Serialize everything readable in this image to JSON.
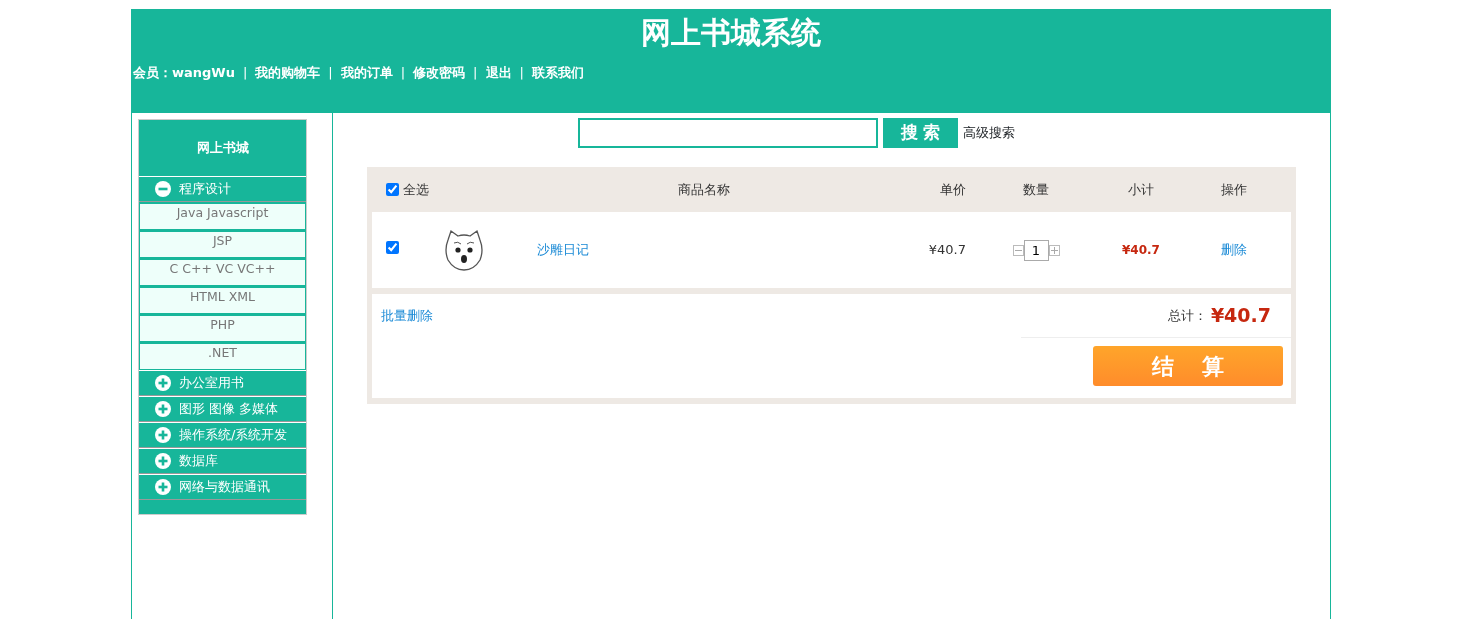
{
  "header": {
    "title": "网上书城系统",
    "member": "会员：wangWu",
    "separator": "|",
    "links": [
      "我的购物车",
      "我的订单",
      "修改密码",
      "退出",
      "联系我们"
    ]
  },
  "sidebar": {
    "title": "网上书城",
    "categories": [
      {
        "label": "程序设计",
        "expanded": true,
        "children": [
          "Java Javascript",
          "JSP",
          "C C++ VC VC++",
          "HTML XML",
          "PHP",
          ".NET"
        ]
      },
      {
        "label": "办公室用书",
        "expanded": false
      },
      {
        "label": "图形 图像 多媒体",
        "expanded": false
      },
      {
        "label": "操作系统/系统开发",
        "expanded": false
      },
      {
        "label": "数据库",
        "expanded": false
      },
      {
        "label": "网络与数据通讯",
        "expanded": false
      }
    ]
  },
  "search": {
    "button": "搜 索",
    "advanced": "高级搜索"
  },
  "cart": {
    "select_all": {
      "label": "全选",
      "checked": true
    },
    "columns": [
      "商品名称",
      "单价",
      "数量",
      "小计",
      "操作"
    ],
    "rows": [
      {
        "checked": true,
        "name": "沙雕日记",
        "price": "¥40.7",
        "quantity": "1",
        "subtotal": "¥40.7",
        "action": "删除"
      }
    ],
    "batch_delete": "批量删除",
    "total_label": "总计：",
    "total": "¥40.7",
    "checkout": "结 算"
  }
}
